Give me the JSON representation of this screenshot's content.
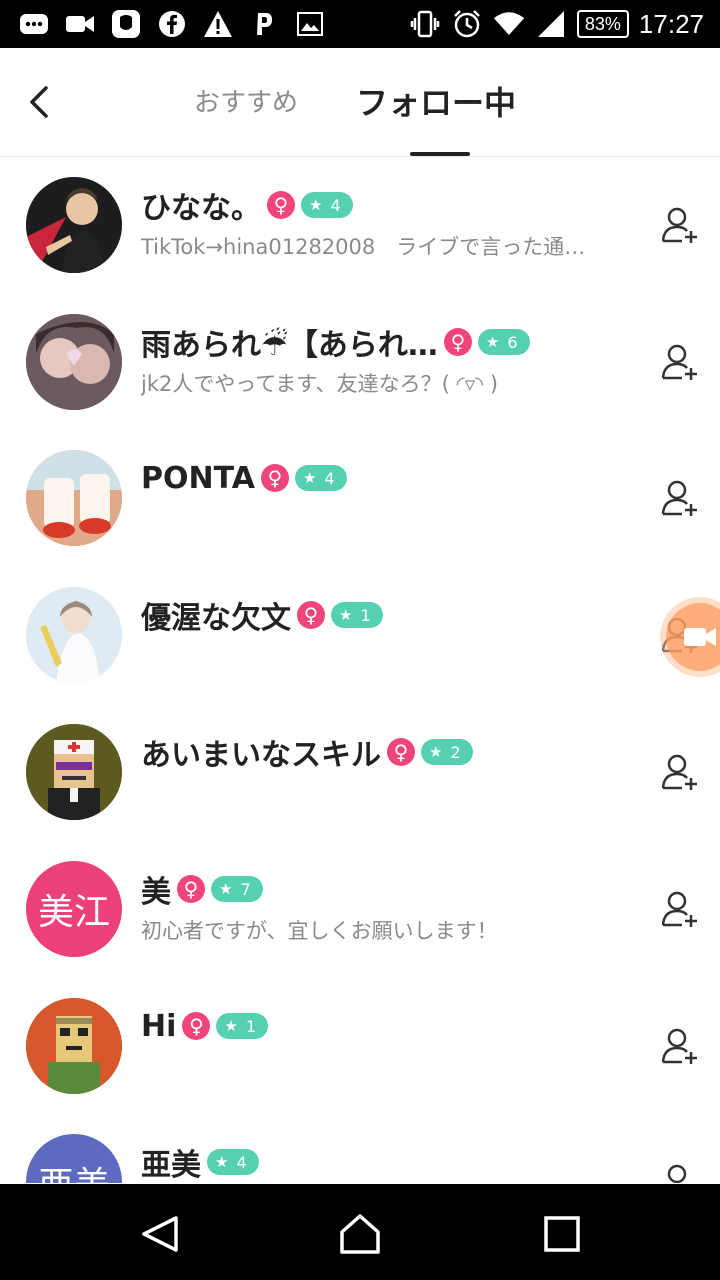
{
  "status_bar": {
    "battery": "83%",
    "time": "17:27",
    "left_icons": [
      "chat-icon",
      "video-camera-icon",
      "app-icon",
      "facebook-icon",
      "warning-icon",
      "p-app-icon",
      "image-icon"
    ],
    "right_icons": [
      "vibrate-icon",
      "alarm-icon",
      "wifi-icon",
      "signal-icon",
      "battery-icon"
    ]
  },
  "header": {
    "tabs": [
      {
        "label": "おすすめ",
        "active": false
      },
      {
        "label": "フォロー中",
        "active": true
      }
    ]
  },
  "users": [
    {
      "name": "ひなな。",
      "gender": "♀",
      "level": "4",
      "bio": "TikTok→hina01282008　ライブで言った通…",
      "avatar_color": "#b8273a"
    },
    {
      "name": "雨あられ☔【あられ…",
      "gender": "♀",
      "level": "6",
      "bio": "jk2人でやってます、友達なろ？( ◜▿◝ )",
      "avatar_color": "#7d6a74"
    },
    {
      "name": "PONTA",
      "gender": "♀",
      "level": "4",
      "bio": "",
      "avatar_color": "#e9b9a0"
    },
    {
      "name": "優渥な欠文",
      "gender": "♀",
      "level": "1",
      "bio": "",
      "avatar_color": "#cfe0ef"
    },
    {
      "name": "あいまいなスキル",
      "gender": "♀",
      "level": "2",
      "bio": "",
      "avatar_color": "#5a5a18"
    },
    {
      "name": "美",
      "gender": "♀",
      "level": "7",
      "bio": "初心者ですが、宜しくお願いします！",
      "avatar_color": "#ec407a",
      "avatar_text": "美江"
    },
    {
      "name": "Hi",
      "gender": "♀",
      "level": "1",
      "bio": "",
      "avatar_color": "#d9552c"
    },
    {
      "name": "亜美",
      "gender": "",
      "level": "4",
      "bio": "",
      "avatar_color": "#5c6bc0",
      "avatar_text": "亜美"
    }
  ],
  "colors": {
    "female_badge": "#f0457a",
    "level_badge": "#55d0b0",
    "floating_button": "#ffa064"
  },
  "nav_bar": [
    "back-icon",
    "home-icon",
    "recents-icon"
  ]
}
